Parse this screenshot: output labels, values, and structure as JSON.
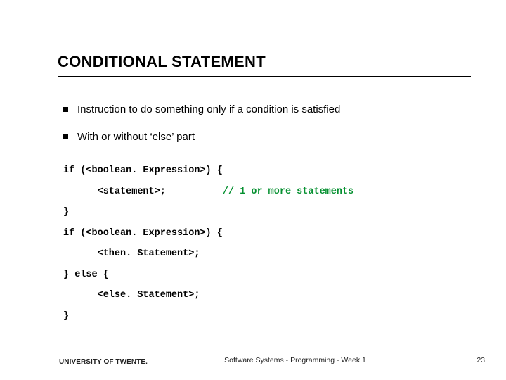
{
  "title": "CONDITIONAL STATEMENT",
  "bullets": [
    "Instruction to do something only if a condition is satisfied",
    "With or without ‘else’ part"
  ],
  "code": {
    "l1": "if (<boolean. Expression>) {",
    "l2a": "      <statement>;",
    "l2b": "          // 1 or more statements",
    "l3": "}",
    "l4": "if (<boolean. Expression>) {",
    "l5": "      <then. Statement>;",
    "l6": "} else {",
    "l7": "      <else. Statement>;",
    "l8": "}"
  },
  "footer": {
    "org": "UNIVERSITY OF TWENTE.",
    "center": "Software Systems - Programming - Week 1",
    "page": "23"
  }
}
